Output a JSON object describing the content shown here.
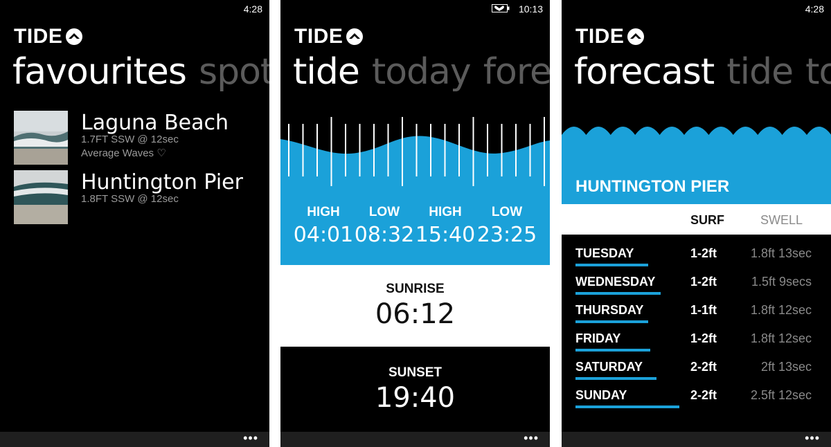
{
  "colors": {
    "accent": "#1ba1d9",
    "background": "#000000",
    "inactive_text": "#5b5b5b",
    "secondary_text": "#9a9a9a"
  },
  "app": {
    "brand": "TIDE",
    "more_icon": "ellipsis-icon",
    "more_label": "•••"
  },
  "panel1": {
    "clock": "4:28",
    "pivot_active": "favourites",
    "pivot_next": "spot",
    "favourites": [
      {
        "name": "Laguna Beach",
        "swell": "1.7FT SSW @ 12sec",
        "rating": "Average Waves ♡"
      },
      {
        "name": "Huntington Pier",
        "swell": "1.8FT SSW @ 12sec",
        "rating": ""
      }
    ]
  },
  "panel2": {
    "clock": "10:13",
    "pivot_active": "tide",
    "pivot_next": "today",
    "pivot_next2": "fore",
    "tides": [
      {
        "type": "HIGH",
        "time": "04:01"
      },
      {
        "type": "LOW",
        "time": "08:32"
      },
      {
        "type": "HIGH",
        "time": "15:40"
      },
      {
        "type": "LOW",
        "time": "23:25"
      }
    ],
    "sunrise_label": "SUNRISE",
    "sunrise_time": "06:12",
    "sunset_label": "SUNSET",
    "sunset_time": "19:40"
  },
  "panel3": {
    "clock": "4:28",
    "pivot_active": "forecast",
    "pivot_next": "tide",
    "pivot_next2": "to",
    "spot": "HUNTINGTON PIER",
    "col_surf": "SURF",
    "col_swell": "SWELL",
    "days": [
      {
        "day": "TUESDAY",
        "surf": "1-2ft",
        "swell": "1.8ft  13sec",
        "bar": 0.7
      },
      {
        "day": "WEDNESDAY",
        "surf": "1-2ft",
        "swell": "1.5ft  9secs",
        "bar": 0.82
      },
      {
        "day": "THURSDAY",
        "surf": "1-1ft",
        "swell": "1.8ft  12sec",
        "bar": 0.7
      },
      {
        "day": "FRIDAY",
        "surf": "1-2ft",
        "swell": "1.8ft  12sec",
        "bar": 0.72
      },
      {
        "day": "SATURDAY",
        "surf": "2-2ft",
        "swell": "2ft  13sec",
        "bar": 0.78
      },
      {
        "day": "SUNDAY",
        "surf": "2-2ft",
        "swell": "2.5ft  12sec",
        "bar": 1.0
      }
    ]
  }
}
